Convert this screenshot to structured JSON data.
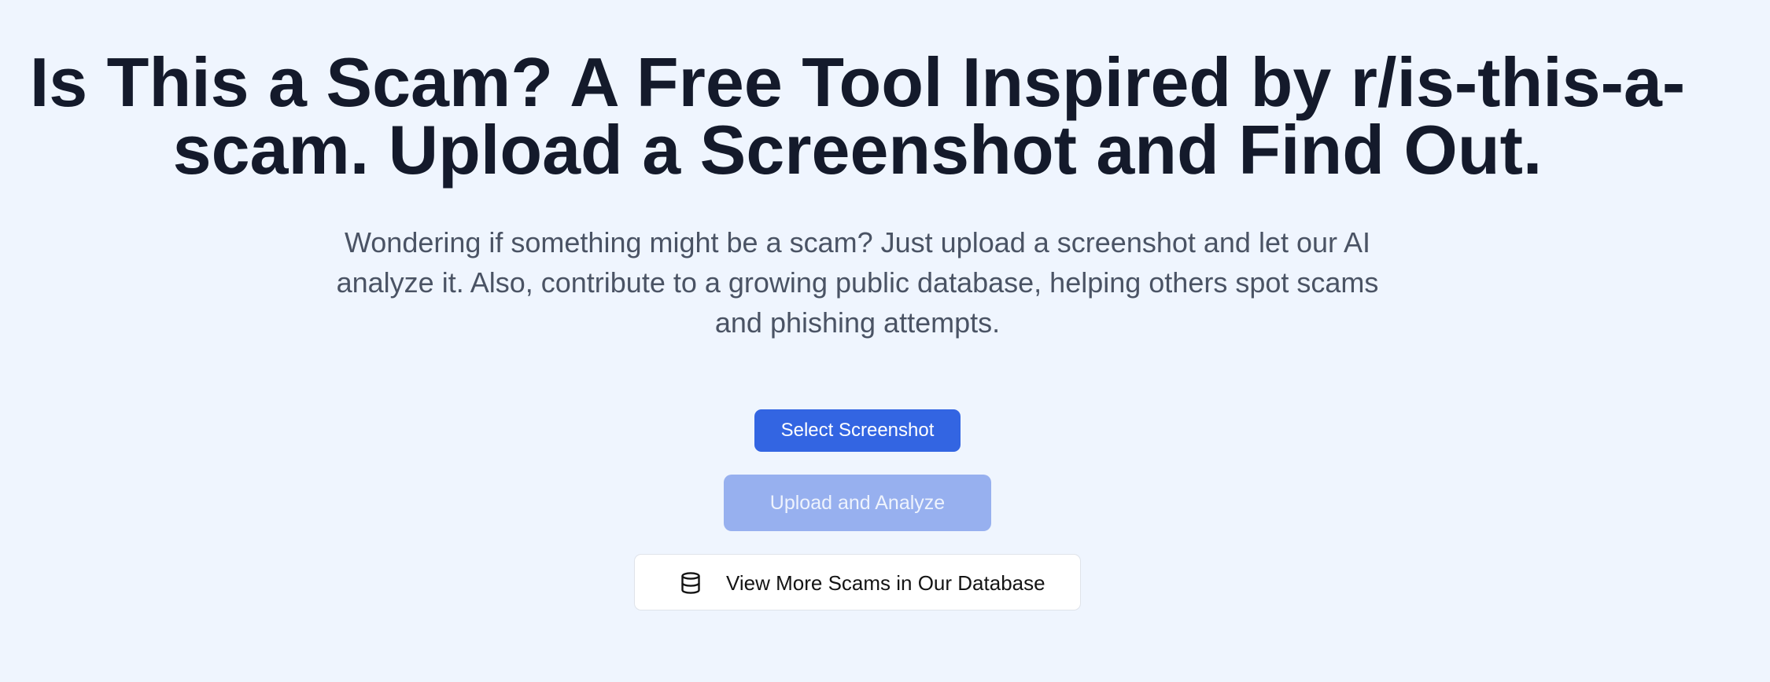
{
  "hero": {
    "title": "Is This a Scam? A Free Tool Inspired by r/is-this-a-scam. Upload a Screenshot and Find Out.",
    "subtitle": "Wondering if something might be a scam? Just upload a screenshot and let our AI analyze it. Also, contribute to a growing public database, helping others spot scams and phishing attempts."
  },
  "actions": {
    "select_label": "Select Screenshot",
    "upload_label": "Upload and Analyze",
    "upload_state": "disabled",
    "database_label": "View More Scams in Our Database",
    "database_icon": "database-icon"
  },
  "colors": {
    "background": "#eff5fe",
    "title": "#141a2b",
    "subtitle": "#4a5364",
    "primary": "#3365e2",
    "primary_disabled": "#97b0ef",
    "secondary_bg": "#ffffff"
  }
}
